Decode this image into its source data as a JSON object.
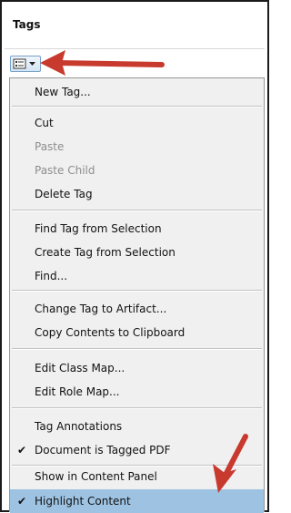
{
  "panel": {
    "title": "Tags"
  },
  "toolbar": {
    "options_icon": "options-menu-icon"
  },
  "menu": {
    "items": [
      {
        "label": "New Tag...",
        "enabled": true,
        "checked": false
      },
      {
        "label": "Cut",
        "enabled": true,
        "checked": false
      },
      {
        "label": "Paste",
        "enabled": false,
        "checked": false
      },
      {
        "label": "Paste Child",
        "enabled": false,
        "checked": false
      },
      {
        "label": "Delete Tag",
        "enabled": true,
        "checked": false
      },
      {
        "label": "Find Tag from Selection",
        "enabled": true,
        "checked": false
      },
      {
        "label": "Create Tag from Selection",
        "enabled": true,
        "checked": false
      },
      {
        "label": "Find...",
        "enabled": true,
        "checked": false
      },
      {
        "label": "Change Tag to Artifact...",
        "enabled": true,
        "checked": false
      },
      {
        "label": "Copy Contents to Clipboard",
        "enabled": true,
        "checked": false
      },
      {
        "label": "Edit Class Map...",
        "enabled": true,
        "checked": false
      },
      {
        "label": "Edit Role Map...",
        "enabled": true,
        "checked": false
      },
      {
        "label": "Tag Annotations",
        "enabled": true,
        "checked": false
      },
      {
        "label": "Document is Tagged PDF",
        "enabled": true,
        "checked": true
      },
      {
        "label": "Show in Content Panel",
        "enabled": true,
        "checked": false
      },
      {
        "label": "Highlight Content",
        "enabled": true,
        "checked": true,
        "highlighted": true
      }
    ]
  },
  "colors": {
    "arrow": "#c8392e",
    "highlight": "#9ec3e2",
    "menu_bg": "#f0f0f0"
  },
  "annotations": {
    "arrow_icon": "red-arrow-icon"
  }
}
